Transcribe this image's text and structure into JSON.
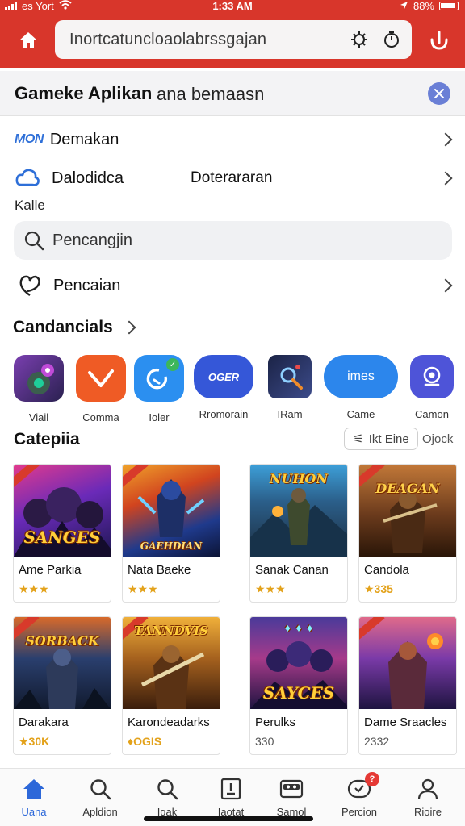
{
  "status": {
    "carrier": "es Yort",
    "time": "1:33 AM",
    "battery": "88%"
  },
  "header": {
    "search_text": "Inortcatuncloaolabrssgajan",
    "title": "Gameke Aplikan",
    "subtitle": "ana bemaasn"
  },
  "menu": {
    "row1_tag": "MON",
    "row1_label": "Demakan",
    "row2_label": "Dalodidca",
    "row2_value": "Doterararan",
    "row2_sub": "Kalle",
    "search_text": "Pencangjin",
    "row3_label": "Pencaian"
  },
  "sections": {
    "candidates": "Candancials",
    "category": "Catepiia"
  },
  "categories": [
    {
      "label": "Viail"
    },
    {
      "label": "Comma"
    },
    {
      "label": "Ioler"
    },
    {
      "label": "Rromorain",
      "icon_text": "OGER"
    },
    {
      "label": "IRam"
    },
    {
      "label": "Came",
      "icon_text": "imes"
    },
    {
      "label": "Camon"
    }
  ],
  "filter": {
    "label": "Ikt Eine",
    "extra": "Ojock"
  },
  "games": [
    {
      "name": "Ame Parkia",
      "rating": "★★★",
      "art_title": "SANGES"
    },
    {
      "name": "Nata Baeke",
      "rating": "★★★",
      "art_title": "GAEHDIAN"
    },
    {
      "name": "Sanak Canan",
      "rating": "★★★",
      "art_title": "NUHON"
    },
    {
      "name": "Candola",
      "rating": "★335",
      "art_title": "DEAGAN"
    },
    {
      "name": "Darakara",
      "rating": "★30K",
      "art_title": "SORBACK"
    },
    {
      "name": "Karondeadarks",
      "rating": "♦OGIS",
      "art_title": "TANNDVIS"
    },
    {
      "name": "Perulks",
      "rating": "330",
      "art_title": "SAYCES"
    },
    {
      "name": "Dame Sraacles",
      "rating": "2332",
      "art_title": ""
    }
  ],
  "nav": [
    {
      "label": "Uana"
    },
    {
      "label": "Apldion"
    },
    {
      "label": "Iqak"
    },
    {
      "label": "Iaotat"
    },
    {
      "label": "Samol"
    },
    {
      "label": "Percion",
      "badge": "?"
    },
    {
      "label": "Rioire"
    }
  ],
  "colors": {
    "brand_red": "#d8362b",
    "accent_blue": "#2d68d9",
    "star_gold": "#e3a21b"
  }
}
